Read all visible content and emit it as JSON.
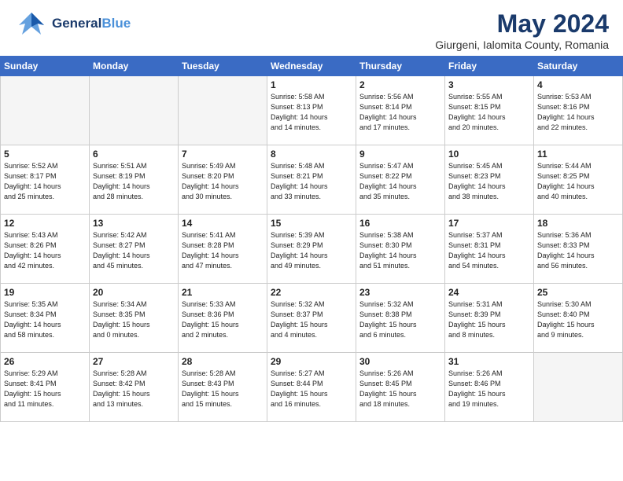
{
  "header": {
    "logo_general": "General",
    "logo_blue": "Blue",
    "month_title": "May 2024",
    "location": "Giurgeni, Ialomita County, Romania"
  },
  "days_of_week": [
    "Sunday",
    "Monday",
    "Tuesday",
    "Wednesday",
    "Thursday",
    "Friday",
    "Saturday"
  ],
  "weeks": [
    [
      {
        "day": "",
        "info": ""
      },
      {
        "day": "",
        "info": ""
      },
      {
        "day": "",
        "info": ""
      },
      {
        "day": "1",
        "info": "Sunrise: 5:58 AM\nSunset: 8:13 PM\nDaylight: 14 hours\nand 14 minutes."
      },
      {
        "day": "2",
        "info": "Sunrise: 5:56 AM\nSunset: 8:14 PM\nDaylight: 14 hours\nand 17 minutes."
      },
      {
        "day": "3",
        "info": "Sunrise: 5:55 AM\nSunset: 8:15 PM\nDaylight: 14 hours\nand 20 minutes."
      },
      {
        "day": "4",
        "info": "Sunrise: 5:53 AM\nSunset: 8:16 PM\nDaylight: 14 hours\nand 22 minutes."
      }
    ],
    [
      {
        "day": "5",
        "info": "Sunrise: 5:52 AM\nSunset: 8:17 PM\nDaylight: 14 hours\nand 25 minutes."
      },
      {
        "day": "6",
        "info": "Sunrise: 5:51 AM\nSunset: 8:19 PM\nDaylight: 14 hours\nand 28 minutes."
      },
      {
        "day": "7",
        "info": "Sunrise: 5:49 AM\nSunset: 8:20 PM\nDaylight: 14 hours\nand 30 minutes."
      },
      {
        "day": "8",
        "info": "Sunrise: 5:48 AM\nSunset: 8:21 PM\nDaylight: 14 hours\nand 33 minutes."
      },
      {
        "day": "9",
        "info": "Sunrise: 5:47 AM\nSunset: 8:22 PM\nDaylight: 14 hours\nand 35 minutes."
      },
      {
        "day": "10",
        "info": "Sunrise: 5:45 AM\nSunset: 8:23 PM\nDaylight: 14 hours\nand 38 minutes."
      },
      {
        "day": "11",
        "info": "Sunrise: 5:44 AM\nSunset: 8:25 PM\nDaylight: 14 hours\nand 40 minutes."
      }
    ],
    [
      {
        "day": "12",
        "info": "Sunrise: 5:43 AM\nSunset: 8:26 PM\nDaylight: 14 hours\nand 42 minutes."
      },
      {
        "day": "13",
        "info": "Sunrise: 5:42 AM\nSunset: 8:27 PM\nDaylight: 14 hours\nand 45 minutes."
      },
      {
        "day": "14",
        "info": "Sunrise: 5:41 AM\nSunset: 8:28 PM\nDaylight: 14 hours\nand 47 minutes."
      },
      {
        "day": "15",
        "info": "Sunrise: 5:39 AM\nSunset: 8:29 PM\nDaylight: 14 hours\nand 49 minutes."
      },
      {
        "day": "16",
        "info": "Sunrise: 5:38 AM\nSunset: 8:30 PM\nDaylight: 14 hours\nand 51 minutes."
      },
      {
        "day": "17",
        "info": "Sunrise: 5:37 AM\nSunset: 8:31 PM\nDaylight: 14 hours\nand 54 minutes."
      },
      {
        "day": "18",
        "info": "Sunrise: 5:36 AM\nSunset: 8:33 PM\nDaylight: 14 hours\nand 56 minutes."
      }
    ],
    [
      {
        "day": "19",
        "info": "Sunrise: 5:35 AM\nSunset: 8:34 PM\nDaylight: 14 hours\nand 58 minutes."
      },
      {
        "day": "20",
        "info": "Sunrise: 5:34 AM\nSunset: 8:35 PM\nDaylight: 15 hours\nand 0 minutes."
      },
      {
        "day": "21",
        "info": "Sunrise: 5:33 AM\nSunset: 8:36 PM\nDaylight: 15 hours\nand 2 minutes."
      },
      {
        "day": "22",
        "info": "Sunrise: 5:32 AM\nSunset: 8:37 PM\nDaylight: 15 hours\nand 4 minutes."
      },
      {
        "day": "23",
        "info": "Sunrise: 5:32 AM\nSunset: 8:38 PM\nDaylight: 15 hours\nand 6 minutes."
      },
      {
        "day": "24",
        "info": "Sunrise: 5:31 AM\nSunset: 8:39 PM\nDaylight: 15 hours\nand 8 minutes."
      },
      {
        "day": "25",
        "info": "Sunrise: 5:30 AM\nSunset: 8:40 PM\nDaylight: 15 hours\nand 9 minutes."
      }
    ],
    [
      {
        "day": "26",
        "info": "Sunrise: 5:29 AM\nSunset: 8:41 PM\nDaylight: 15 hours\nand 11 minutes."
      },
      {
        "day": "27",
        "info": "Sunrise: 5:28 AM\nSunset: 8:42 PM\nDaylight: 15 hours\nand 13 minutes."
      },
      {
        "day": "28",
        "info": "Sunrise: 5:28 AM\nSunset: 8:43 PM\nDaylight: 15 hours\nand 15 minutes."
      },
      {
        "day": "29",
        "info": "Sunrise: 5:27 AM\nSunset: 8:44 PM\nDaylight: 15 hours\nand 16 minutes."
      },
      {
        "day": "30",
        "info": "Sunrise: 5:26 AM\nSunset: 8:45 PM\nDaylight: 15 hours\nand 18 minutes."
      },
      {
        "day": "31",
        "info": "Sunrise: 5:26 AM\nSunset: 8:46 PM\nDaylight: 15 hours\nand 19 minutes."
      },
      {
        "day": "",
        "info": ""
      }
    ]
  ]
}
